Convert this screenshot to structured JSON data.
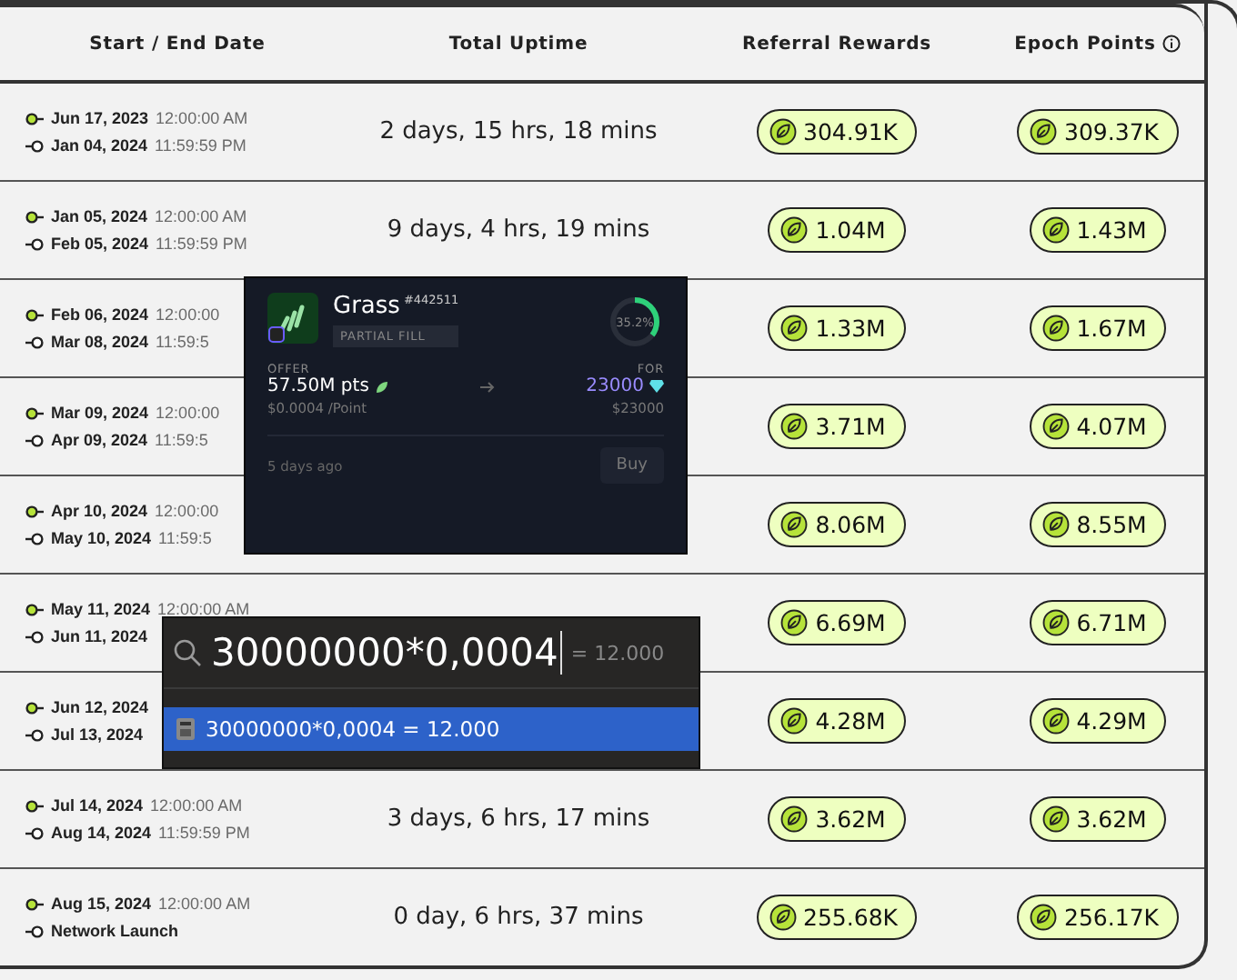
{
  "table": {
    "columns": [
      {
        "label": "Start / End Date"
      },
      {
        "label": "Total Uptime"
      },
      {
        "label": "Referral Rewards"
      },
      {
        "label": "Epoch Points",
        "info": true
      }
    ],
    "rows": [
      {
        "start_date": "Jun 17, 2023",
        "start_time": "12:00:00 AM",
        "end_date": "Jan 04, 2024",
        "end_time": "11:59:59 PM",
        "uptime": "2 days, 15 hrs, 18 mins",
        "referral": "304.91K",
        "epoch": "309.37K"
      },
      {
        "start_date": "Jan 05, 2024",
        "start_time": "12:00:00 AM",
        "end_date": "Feb 05, 2024",
        "end_time": "11:59:59 PM",
        "uptime": "9 days, 4 hrs, 19 mins",
        "referral": "1.04M",
        "epoch": "1.43M"
      },
      {
        "start_date": "Feb 06, 2024",
        "start_time": "12:00:00",
        "end_date": "Mar 08, 2024",
        "end_time": "11:59:5",
        "referral": "1.33M",
        "epoch": "1.67M"
      },
      {
        "start_date": "Mar 09, 2024",
        "start_time": "12:00:00",
        "end_date": "Apr 09, 2024",
        "end_time": "11:59:5",
        "referral": "3.71M",
        "epoch": "4.07M"
      },
      {
        "start_date": "Apr 10, 2024",
        "start_time": "12:00:00",
        "end_date": "May 10, 2024",
        "end_time": "11:59:5",
        "referral": "8.06M",
        "epoch": "8.55M"
      },
      {
        "start_date": "May 11, 2024",
        "start_time": "12:00:00 AM",
        "end_date": "Jun 11, 2024",
        "referral": "6.69M",
        "epoch": "6.71M"
      },
      {
        "start_date": "Jun 12, 2024",
        "end_date": "Jul 13, 2024",
        "referral": "4.28M",
        "epoch": "4.29M"
      },
      {
        "start_date": "Jul 14, 2024",
        "start_time": "12:00:00 AM",
        "end_date": "Aug 14, 2024",
        "end_time": "11:59:59 PM",
        "uptime": "3 days, 6 hrs, 17 mins",
        "referral": "3.62M",
        "epoch": "3.62M"
      },
      {
        "start_date": "Aug 15, 2024",
        "start_time": "12:00:00 AM",
        "end_date": "Network Launch",
        "uptime": "0 day, 6 hrs, 37 mins",
        "referral": "255.68K",
        "epoch": "256.17K"
      }
    ]
  },
  "offer_card": {
    "name": "Grass",
    "id": "#442511",
    "badge": "PARTIAL FILL",
    "progress_label": "35.2%",
    "level": 0.352,
    "offer_label": "OFFER",
    "offer_amount": "57.50M pts",
    "offer_price": "$0.0004 /Point",
    "for_label": "FOR",
    "for_amount": "23000",
    "for_usd": "$23000",
    "age": "5 days ago",
    "button": "Buy"
  },
  "calculator": {
    "query": "30000000*0,0004",
    "inline_result": "= 12.000",
    "results": [
      {
        "label": "30000000*0,0004 = 12.000",
        "selected": true
      }
    ]
  }
}
